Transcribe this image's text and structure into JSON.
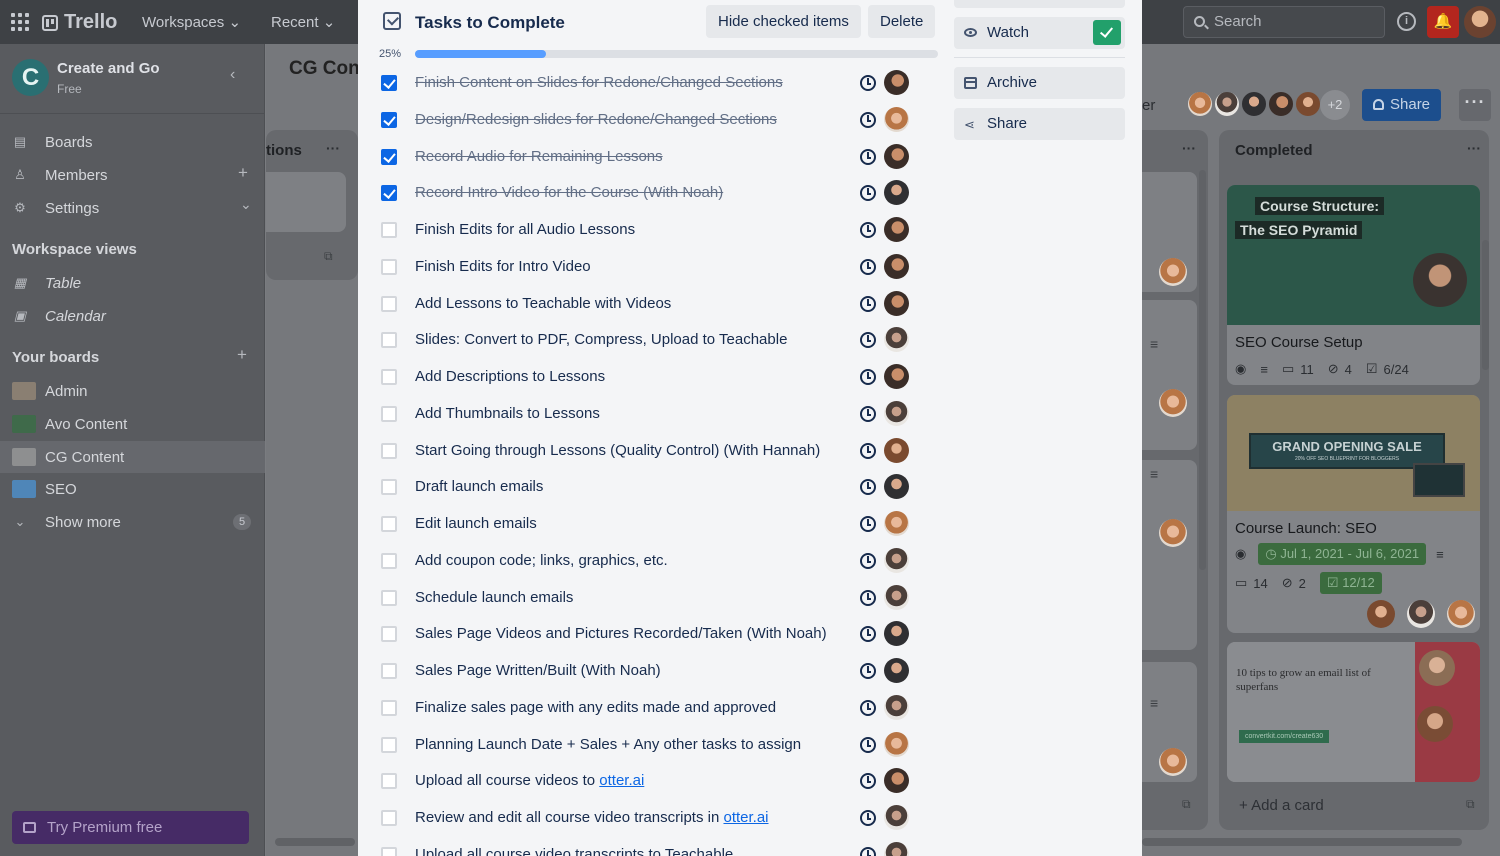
{
  "topbar": {
    "logo_text": "Trello",
    "menus": [
      "Workspaces",
      "Recent"
    ],
    "search_placeholder": "Search",
    "info_glyph": "i",
    "bell_glyph": "🔔"
  },
  "sidebar": {
    "workspace_name": "Create and Go",
    "workspace_letter": "C",
    "workspace_plan": "Free",
    "nav": [
      {
        "label": "Boards",
        "icon": "board-icon"
      },
      {
        "label": "Members",
        "icon": "person-icon"
      },
      {
        "label": "Settings",
        "icon": "gear-icon"
      }
    ],
    "views_heading": "Workspace views",
    "views": [
      {
        "label": "Table",
        "icon": "table-icon"
      },
      {
        "label": "Calendar",
        "icon": "calendar-icon"
      }
    ],
    "boards_heading": "Your boards",
    "boards": [
      {
        "label": "Admin",
        "color": "#8a7f72"
      },
      {
        "label": "Avo Content",
        "color": "#3f6a4a"
      },
      {
        "label": "CG Content",
        "color": "#e1e0dc"
      },
      {
        "label": "SEO",
        "color": "#4f86b8"
      }
    ],
    "show_more_label": "Show more",
    "show_more_count": "5",
    "premium_label": "Try Premium free"
  },
  "board": {
    "title": "CG Con",
    "share_label": "Share",
    "extra_members": "+2",
    "more_glyph": "···",
    "left_list_title": "tions",
    "right_list_partial": "er",
    "completed_title": "Completed",
    "add_card_label": "Add a card"
  },
  "completed_cards": [
    {
      "title": "SEO Course Setup",
      "cover_line1": "Course Structure:",
      "cover_line2": "The SEO Pyramid",
      "comments": "11",
      "attachments": "4",
      "checklist": "6/24"
    },
    {
      "title": "Course Launch: SEO",
      "cover_line1": "GRAND OPENING SALE",
      "cover_line2": "20% OFF SEO BLUEPRINT FOR BLOGGERS",
      "dates": "Jul 1, 2021 - Jul 6, 2021",
      "comments": "14",
      "attachments": "2",
      "checklist": "12/12"
    },
    {
      "cover_line1": "10 tips to grow an email list of superfans",
      "cover_line2": "convertkit.com/create630"
    }
  ],
  "checklist": {
    "title": "Tasks to Complete",
    "hide_label": "Hide checked items",
    "delete_label": "Delete",
    "progress_label": "25%",
    "progress": 0.25,
    "items": [
      {
        "text": "Finish Content on Slides for Redone/Changed Sections",
        "done": true,
        "avatar": "a"
      },
      {
        "text": "Design/Redesign slides for Redone/Changed Sections",
        "done": true,
        "avatar": "b"
      },
      {
        "text": "Record Audio for Remaining Lessons",
        "done": true,
        "avatar": "a"
      },
      {
        "text": "Record Intro Video for the Course (With Noah)",
        "done": true,
        "avatar": "c"
      },
      {
        "text": "Finish Edits for all Audio Lessons",
        "done": false,
        "avatar": "a"
      },
      {
        "text": "Finish Edits for Intro Video",
        "done": false,
        "avatar": "a"
      },
      {
        "text": "Add Lessons to Teachable with Videos",
        "done": false,
        "avatar": "a"
      },
      {
        "text": "Slides: Convert to PDF, Compress, Upload to Teachable",
        "done": false,
        "avatar": "d"
      },
      {
        "text": "Add Descriptions to Lessons",
        "done": false,
        "avatar": "a"
      },
      {
        "text": "Add Thumbnails to Lessons",
        "done": false,
        "avatar": "d"
      },
      {
        "text": "Start Going through Lessons (Quality Control) (With Hannah)",
        "done": false,
        "avatar": "e"
      },
      {
        "text": "Draft launch emails",
        "done": false,
        "avatar": "c"
      },
      {
        "text": "Edit launch emails",
        "done": false,
        "avatar": "b"
      },
      {
        "text": "Add coupon code; links, graphics, etc.",
        "done": false,
        "avatar": "d"
      },
      {
        "text": "Schedule launch emails",
        "done": false,
        "avatar": "d"
      },
      {
        "text": "Sales Page Videos and Pictures Recorded/Taken (With Noah)",
        "done": false,
        "avatar": "c"
      },
      {
        "text": "Sales Page Written/Built (With Noah)",
        "done": false,
        "avatar": "c"
      },
      {
        "text": "Finalize sales page with any edits made and approved",
        "done": false,
        "avatar": "d"
      },
      {
        "text": "Planning Launch Date + Sales + Any other tasks to assign",
        "done": false,
        "avatar": "b"
      },
      {
        "text": "Upload all course videos to ",
        "link": "otter.ai",
        "done": false,
        "avatar": "a"
      },
      {
        "text": "Review and edit all course video transcripts in ",
        "link": "otter.ai",
        "done": false,
        "avatar": "d"
      },
      {
        "text": "Upload all course video transcripts to Teachable",
        "done": false,
        "avatar": "d"
      }
    ]
  },
  "card_sidebar": {
    "watch_label": "Watch",
    "archive_label": "Archive",
    "share_label": "Share"
  }
}
